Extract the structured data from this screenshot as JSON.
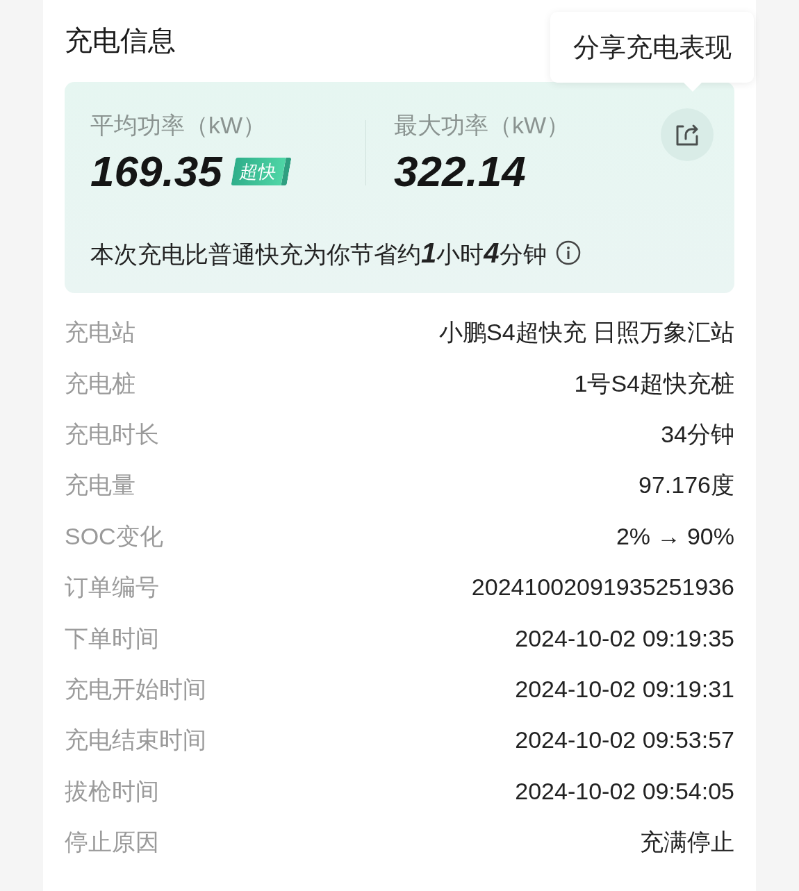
{
  "title": "充电信息",
  "tooltip": "分享充电表现",
  "metrics": [
    {
      "label": "平均功率（kW）",
      "value": "169.35",
      "badge": "超快"
    },
    {
      "label": "最大功率（kW）",
      "value": "322.14"
    }
  ],
  "savings": "本次充电比普通快充为你节省约**1**小时**4**分钟",
  "rows": [
    {
      "label": "充电站",
      "value": "小鹏S4超快充 日照万象汇站"
    },
    {
      "label": "充电桩",
      "value": "1号S4超快充桩"
    },
    {
      "label": "充电时长",
      "value": "34分钟"
    },
    {
      "label": "充电量",
      "value": "97.176度"
    },
    {
      "label": "SOC变化",
      "value": "2% → 90%"
    },
    {
      "label": "订单编号",
      "value": "20241002091935251936"
    },
    {
      "label": "下单时间",
      "value": "2024-10-02 09:19:35"
    },
    {
      "label": "充电开始时间",
      "value": "2024-10-02 09:19:31"
    },
    {
      "label": "充电结束时间",
      "value": "2024-10-02 09:53:57"
    },
    {
      "label": "拔枪时间",
      "value": "2024-10-02 09:54:05"
    },
    {
      "label": "停止原因",
      "value": "充满停止"
    }
  ]
}
